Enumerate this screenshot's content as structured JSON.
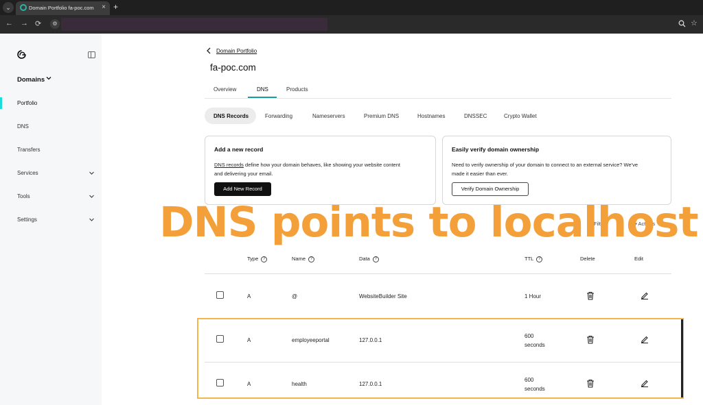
{
  "browser": {
    "tab_title": "Domain Portfolio fa-poc.com",
    "tab_close": "×",
    "new_tab": "+",
    "tab_menu": "⌄",
    "nav": {
      "back": "←",
      "forward": "→",
      "reload": "⟳"
    }
  },
  "sidebar": {
    "section": "Domains",
    "items": [
      {
        "label": "Portfolio",
        "active": true
      },
      {
        "label": "DNS"
      },
      {
        "label": "Transfers"
      },
      {
        "label": "Services",
        "has_chevron": true
      },
      {
        "label": "Tools",
        "has_chevron": true
      },
      {
        "label": "Settings",
        "has_chevron": true
      }
    ]
  },
  "breadcrumb": {
    "label": "Domain Portfolio"
  },
  "page_title": "fa-poc.com",
  "main_tabs": [
    "Overview",
    "DNS",
    "Products"
  ],
  "sub_tabs": [
    "DNS Records",
    "Forwarding",
    "Nameservers",
    "Premium DNS",
    "Hostnames",
    "DNSSEC",
    "Crypto Wallet"
  ],
  "cards": {
    "add_record": {
      "title": "Add a new record",
      "text_link": "DNS records",
      "text_line1_rest": " define how your domain behaves, like showing your website content",
      "text_line2": "and delivering your email.",
      "button": "Add New Record"
    },
    "verify": {
      "title": "Easily verify domain ownership",
      "text_line1": "Need to verify ownership of your domain to connect to an external service? We've",
      "text_line2": "made it easier than ever.",
      "button": "Verify Domain Ownership"
    }
  },
  "overlay_text": "DNS points to localhost",
  "filter_hint": "Filte",
  "actions_hint": "••• Actions",
  "table": {
    "headers": {
      "type": "Type",
      "name": "Name",
      "data": "Data",
      "ttl": "TTL",
      "delete": "Delete",
      "edit": "Edit"
    },
    "rows": [
      {
        "type": "A",
        "name": "@",
        "data": "WebsiteBuilder Site",
        "ttl_line1": "1 Hour",
        "ttl_line2": ""
      },
      {
        "type": "A",
        "name": "employeeportal",
        "data": "127.0.0.1",
        "ttl_line1": "600",
        "ttl_line2": "seconds"
      },
      {
        "type": "A",
        "name": "health",
        "data": "127.0.0.1",
        "ttl_line1": "600",
        "ttl_line2": "seconds"
      }
    ]
  },
  "colors": {
    "accent_teal": "#1bdbdb",
    "overlay_orange": "#f4a03a",
    "highlight_border": "#f4b64a"
  }
}
